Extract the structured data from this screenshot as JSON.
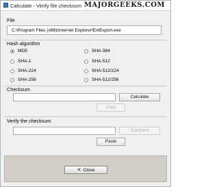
{
  "window": {
    "title": "Calculate - Verify file checksum",
    "watermark": "MAJORGEEKS.COM"
  },
  "file": {
    "label": "File",
    "path": "C:\\Program Files (x86)\\Internet Explorer\\ExtExport.exe"
  },
  "hash": {
    "label": "Hash algorithm",
    "options_left": [
      "MD5",
      "SHA-1",
      "SHA-224",
      "SHA-256"
    ],
    "options_right": [
      "SHA-384",
      "SHA-512",
      "SHA-512/224",
      "SHA-512/256"
    ],
    "selected": "MD5"
  },
  "checksum": {
    "label": "Checksum",
    "value": "",
    "calculate_label": "Calculate",
    "copy_label": "Copy"
  },
  "verify": {
    "label": "Verify the checksum",
    "value": "",
    "compare_label": "Compare",
    "paste_label": "Paste"
  },
  "footer": {
    "close_label": "Close",
    "close_icon": "close-icon"
  }
}
